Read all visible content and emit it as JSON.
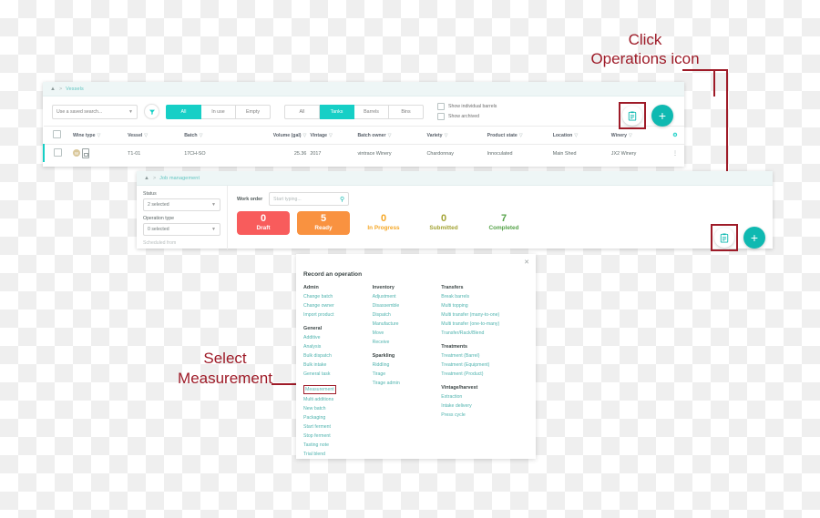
{
  "annotations": {
    "click_line1": "Click",
    "click_line2": "Operations icon",
    "select_line1": "Select",
    "select_line2": "Measurement"
  },
  "vessels_window": {
    "breadcrumb": {
      "home_icon": "home-icon",
      "separator": ">",
      "page": "Vessels"
    },
    "toolbar": {
      "saved_search_value": "Use a saved search...",
      "filter_icon": "funnel-icon",
      "usage_filters": [
        {
          "label": "All",
          "active": true
        },
        {
          "label": "In use",
          "active": false
        },
        {
          "label": "Empty",
          "active": false
        }
      ],
      "type_filters": [
        {
          "label": "All",
          "active": false
        },
        {
          "label": "Tanks",
          "active": true
        },
        {
          "label": "Barrels",
          "active": false
        },
        {
          "label": "Bins",
          "active": false
        }
      ],
      "checkboxes": [
        {
          "label": "Show individual barrels",
          "checked": false
        },
        {
          "label": "Show archived",
          "checked": false
        }
      ],
      "operations_button_icon": "clipboard-icon",
      "add_button_icon": "plus-icon"
    },
    "table": {
      "columns": [
        "Wine type",
        "Vessel",
        "Batch",
        "Volume (gal)",
        "Vintage",
        "Batch owner",
        "Variety",
        "Product state",
        "Location",
        "Winery"
      ],
      "settings_icon": "gear-icon",
      "rows": [
        {
          "wine_type_badge": "W",
          "vessel_icon": "tank-icon",
          "vessel": "T1-01",
          "batch": "17CH-SO",
          "volume_gal": "25.36",
          "vintage": "2017",
          "batch_owner": "vintrace Winery",
          "variety": "Chardonnay",
          "product_state": "Innoculated",
          "location": "Main Shed",
          "winery": "JX2 Winery",
          "row_menu_icon": "kebab-icon"
        }
      ]
    }
  },
  "jobs_window": {
    "breadcrumb": {
      "home_icon": "home-icon",
      "separator": ">",
      "page": "Job management"
    },
    "sidebar": {
      "status_label": "Status",
      "status_value": "2 selected",
      "operation_type_label": "Operation type",
      "operation_type_value": "0 selected",
      "scheduled_from_label": "Scheduled from"
    },
    "work_order": {
      "label": "Work order",
      "placeholder": "Start typing...",
      "search_icon": "search-icon"
    },
    "stats": [
      {
        "count": "0",
        "label": "Draft",
        "style": "draft"
      },
      {
        "count": "5",
        "label": "Ready",
        "style": "ready"
      },
      {
        "count": "0",
        "label": "In Progress",
        "style": "plain-orange"
      },
      {
        "count": "0",
        "label": "Submitted",
        "style": "plain-olive"
      },
      {
        "count": "7",
        "label": "Completed",
        "style": "plain-green"
      }
    ],
    "operations_button_icon": "clipboard-icon",
    "add_button_icon": "plus-icon"
  },
  "record_operation": {
    "title": "Record an operation",
    "close_icon": "close-icon",
    "column1": [
      {
        "group": "Admin",
        "items": [
          {
            "label": "Change batch"
          },
          {
            "label": "Change owner"
          },
          {
            "label": "Import product"
          }
        ]
      },
      {
        "group": "General",
        "items": [
          {
            "label": "Additive"
          },
          {
            "label": "Analysis"
          },
          {
            "label": "Bulk dispatch"
          },
          {
            "label": "Bulk intake"
          },
          {
            "label": "General task"
          },
          {
            "label": "Measurement",
            "highlighted": true
          },
          {
            "label": "Multi additions"
          },
          {
            "label": "New batch"
          },
          {
            "label": "Packaging"
          },
          {
            "label": "Start ferment"
          },
          {
            "label": "Stop ferment"
          },
          {
            "label": "Tasting note"
          },
          {
            "label": "Trial blend"
          }
        ]
      }
    ],
    "column2": [
      {
        "group": "Inventory",
        "items": [
          {
            "label": "Adjustment"
          },
          {
            "label": "Disassemble"
          },
          {
            "label": "Dispatch"
          },
          {
            "label": "Manufacture"
          },
          {
            "label": "Move"
          },
          {
            "label": "Receive"
          }
        ]
      },
      {
        "group": "Sparkling",
        "items": [
          {
            "label": "Riddling"
          },
          {
            "label": "Tirage"
          },
          {
            "label": "Tirage admin"
          }
        ]
      }
    ],
    "column3": [
      {
        "group": "Transfers",
        "items": [
          {
            "label": "Break barrels"
          },
          {
            "label": "Multi topping"
          },
          {
            "label": "Multi transfer (many-to-one)"
          },
          {
            "label": "Multi transfer (one-to-many)"
          },
          {
            "label": "Transfer/Rack/Blend"
          }
        ]
      },
      {
        "group": "Treatments",
        "items": [
          {
            "label": "Treatment (Barrel)"
          },
          {
            "label": "Treatment (Equipment)"
          },
          {
            "label": "Treatment (Product)"
          }
        ]
      },
      {
        "group": "Vintage/harvest",
        "items": [
          {
            "label": "Extraction"
          },
          {
            "label": "Intake delivery"
          },
          {
            "label": "Press cycle"
          }
        ]
      }
    ]
  },
  "colors": {
    "teal": "#16cfc6",
    "teal_dark": "#0fb9b1",
    "annotation_red": "#9e1b28",
    "draft_red": "#f85c5c",
    "ready_orange": "#f99240",
    "in_progress": "#f5a623",
    "submitted": "#a3a334",
    "completed": "#57a34a"
  }
}
